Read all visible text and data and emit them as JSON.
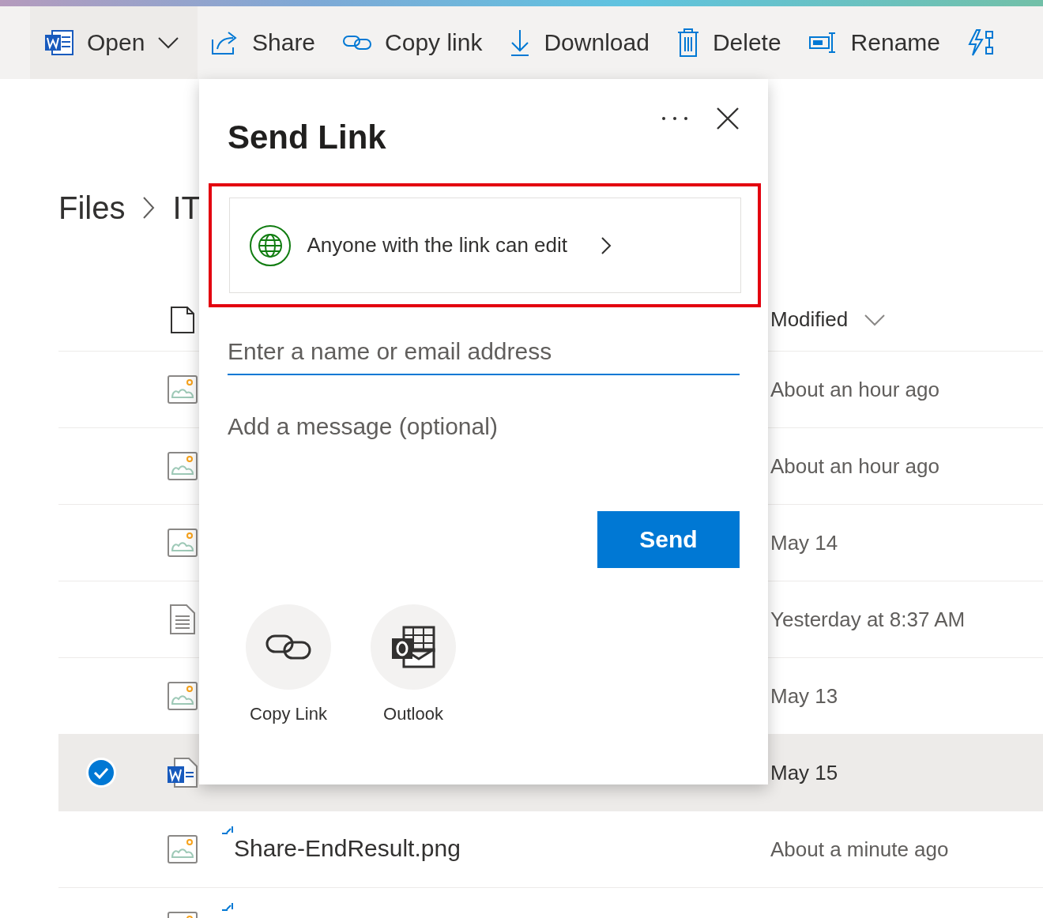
{
  "toolbar": [
    {
      "label": "Open",
      "kind": "word",
      "dropdown": true
    },
    {
      "label": "Share",
      "kind": "share",
      "dropdown": false
    },
    {
      "label": "Copy link",
      "kind": "link",
      "dropdown": false
    },
    {
      "label": "Download",
      "kind": "download",
      "dropdown": false
    },
    {
      "label": "Delete",
      "kind": "delete",
      "dropdown": false
    },
    {
      "label": "Rename",
      "kind": "rename",
      "dropdown": false
    },
    {
      "kind": "flow",
      "dropdown": false
    }
  ],
  "breadcrumb": [
    "Files",
    "IT"
  ],
  "table": {
    "modified_header": "Modified",
    "rows": [
      {
        "kind": "image",
        "modified": "About an hour ago",
        "selected": false,
        "new": false
      },
      {
        "kind": "image",
        "modified": "About an hour ago",
        "selected": false,
        "new": false
      },
      {
        "kind": "image",
        "modified": "May 14",
        "selected": false,
        "new": false
      },
      {
        "kind": "text",
        "modified": "Yesterday at 8:37 AM",
        "selected": false,
        "new": false
      },
      {
        "kind": "image",
        "modified": "May 13",
        "selected": false,
        "new": false
      },
      {
        "kind": "word",
        "modified": "May 15",
        "selected": true,
        "new": false
      },
      {
        "kind": "image",
        "name": "Share-EndResult.png",
        "modified": "About a minute ago",
        "selected": false,
        "new": true
      },
      {
        "kind": "image",
        "selected": false,
        "new": true
      }
    ]
  },
  "dialog": {
    "title": "Send Link",
    "link_setting": {
      "label": "Anyone with the link can edit",
      "highlighted": true
    },
    "recipient_field": {
      "placeholder": "Enter a name or email address"
    },
    "message_field": {
      "placeholder": "Add a message (optional)"
    },
    "send_button": "Send",
    "share_options": [
      {
        "label": "Copy Link",
        "kind": "link"
      },
      {
        "label": "Outlook",
        "kind": "outlook"
      }
    ]
  }
}
